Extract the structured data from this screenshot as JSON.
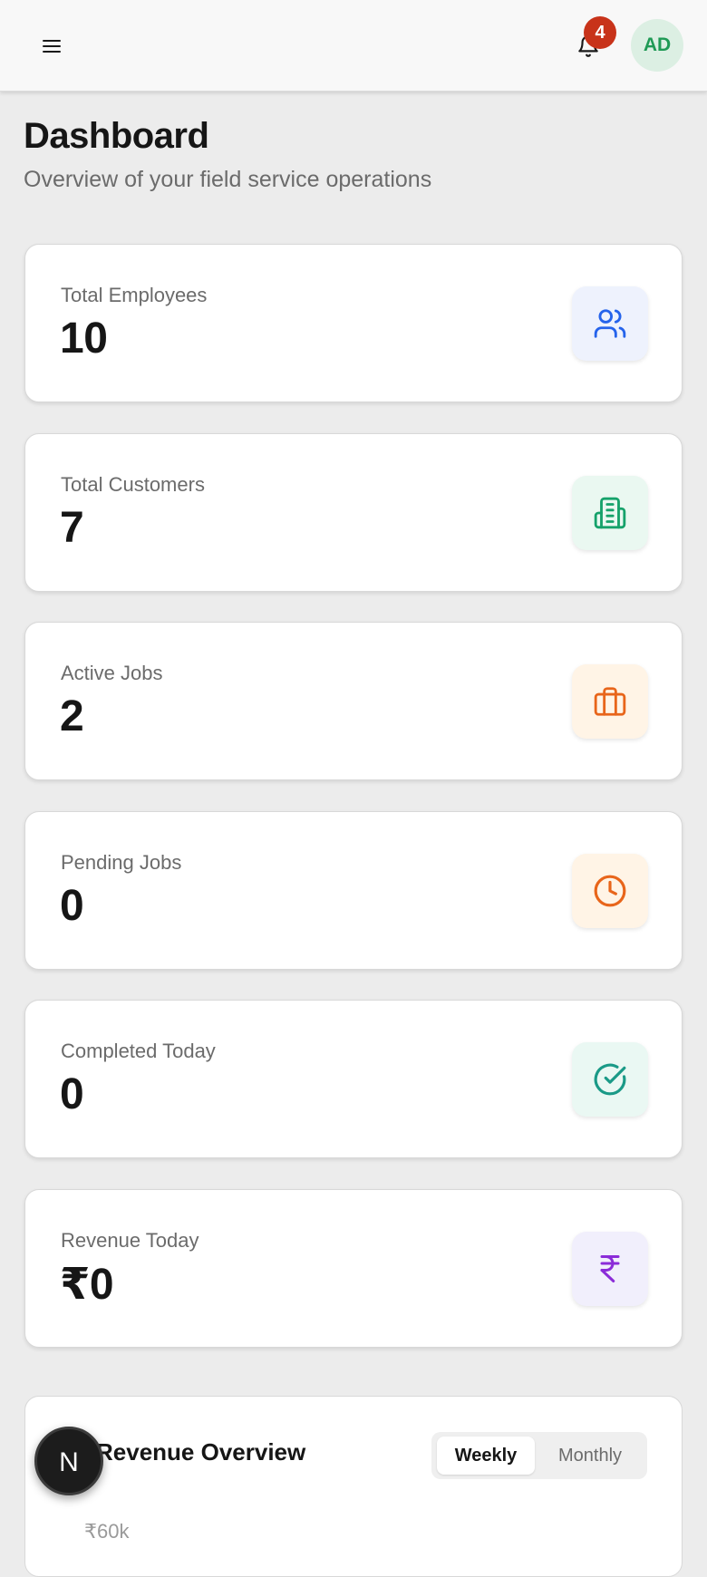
{
  "header": {
    "menu_icon": "hamburger-menu-icon",
    "notifications": {
      "icon": "bell-icon",
      "count": "4",
      "badge_color": "#c8331a"
    },
    "avatar": {
      "initials": "AD",
      "bg_color": "#dcefe3",
      "text_color": "#1f9a55"
    }
  },
  "page": {
    "title": "Dashboard",
    "subtitle": "Overview of your field service operations"
  },
  "stats": [
    {
      "label": "Total Employees",
      "value": "10",
      "icon": "users-icon",
      "icon_color": "#2563eb",
      "icon_bg": "#eef2fd"
    },
    {
      "label": "Total Customers",
      "value": "7",
      "icon": "building-icon",
      "icon_color": "#16a26b",
      "icon_bg": "#eaf8f1"
    },
    {
      "label": "Active Jobs",
      "value": "2",
      "icon": "briefcase-icon",
      "icon_color": "#e8651a",
      "icon_bg": "#fff4e6"
    },
    {
      "label": "Pending Jobs",
      "value": "0",
      "icon": "clock-icon",
      "icon_color": "#e8651a",
      "icon_bg": "#fff4e6"
    },
    {
      "label": "Completed Today",
      "value": "0",
      "icon": "check-circle-icon",
      "icon_color": "#1a9a87",
      "icon_bg": "#eaf8f3"
    },
    {
      "label": "Revenue Today",
      "value": "₹0",
      "icon": "rupee-icon",
      "icon_color": "#8b2cd8",
      "icon_bg": "#f1effc"
    }
  ],
  "revenue": {
    "title": "Revenue Overview",
    "toggle": {
      "weekly": "Weekly",
      "monthly": "Monthly",
      "selected": "Weekly"
    },
    "axis_tick": "₹60k"
  },
  "overlay": {
    "badge_letter": "N",
    "icon": "nextjs-logo-icon"
  }
}
